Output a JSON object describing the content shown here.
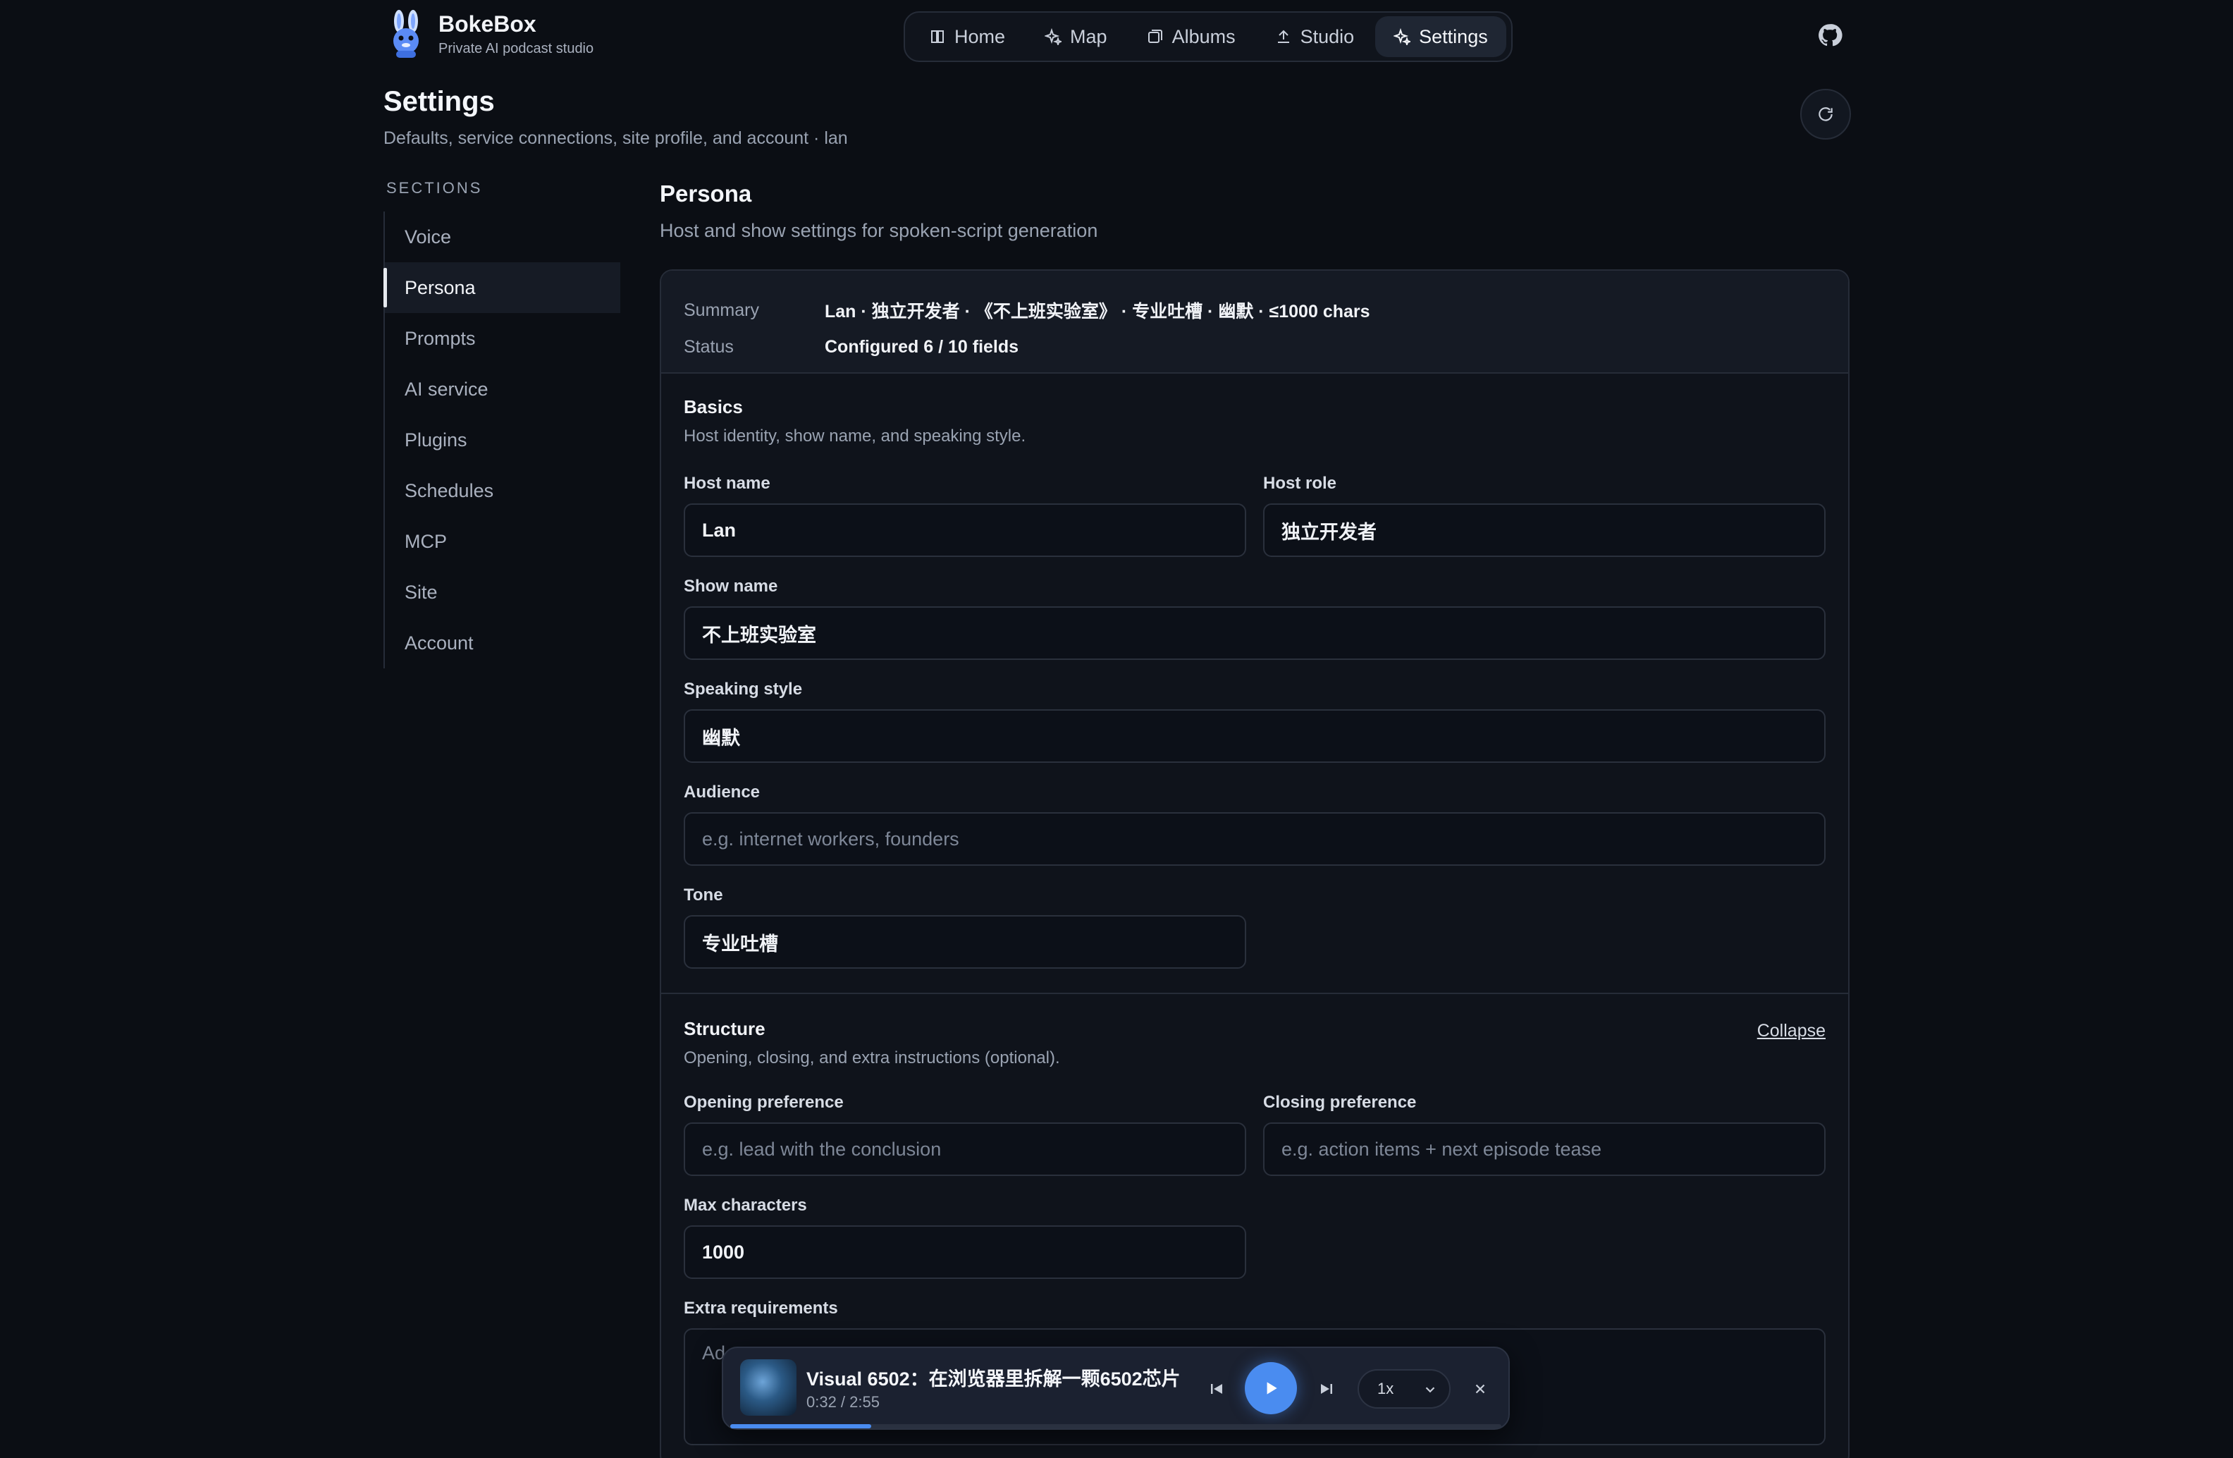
{
  "brand": {
    "name": "BokeBox",
    "tagline": "Private AI podcast studio"
  },
  "nav": [
    {
      "label": "Home",
      "icon": "book-icon"
    },
    {
      "label": "Map",
      "icon": "sparkles-icon"
    },
    {
      "label": "Albums",
      "icon": "albums-icon"
    },
    {
      "label": "Studio",
      "icon": "upload-icon"
    },
    {
      "label": "Settings",
      "icon": "sparkle-icon",
      "active": true
    }
  ],
  "page": {
    "title": "Settings",
    "subtitle": "Defaults, service connections, site profile, and account · lan"
  },
  "sidebar": {
    "heading": "SECTIONS",
    "items": [
      {
        "label": "Voice"
      },
      {
        "label": "Persona",
        "active": true
      },
      {
        "label": "Prompts"
      },
      {
        "label": "AI service"
      },
      {
        "label": "Plugins"
      },
      {
        "label": "Schedules"
      },
      {
        "label": "MCP"
      },
      {
        "label": "Site"
      },
      {
        "label": "Account"
      }
    ]
  },
  "section": {
    "title": "Persona",
    "subtitle": "Host and show settings for spoken-script generation",
    "summary": {
      "summary_label": "Summary",
      "summary_value": "Lan · 独立开发者 · 《不上班实验室》 · 专业吐槽 · 幽默 · ≤1000 chars",
      "status_label": "Status",
      "status_value": "Configured 6 / 10 fields"
    },
    "basics": {
      "title": "Basics",
      "desc": "Host identity, show name, and speaking style.",
      "host_name": {
        "label": "Host name",
        "value": "Lan"
      },
      "host_role": {
        "label": "Host role",
        "value": "独立开发者"
      },
      "show_name": {
        "label": "Show name",
        "value": "不上班实验室"
      },
      "speaking_style": {
        "label": "Speaking style",
        "value": "幽默"
      },
      "audience": {
        "label": "Audience",
        "placeholder": "e.g. internet workers, founders"
      },
      "tone": {
        "label": "Tone",
        "value": "专业吐槽"
      }
    },
    "structure": {
      "title": "Structure",
      "desc": "Opening, closing, and extra instructions (optional).",
      "collapse": "Collapse",
      "opening": {
        "label": "Opening preference",
        "placeholder": "e.g. lead with the conclusion"
      },
      "closing": {
        "label": "Closing preference",
        "placeholder": "e.g. action items + next episode tease"
      },
      "max_chars": {
        "label": "Max characters",
        "value": "1000"
      },
      "extra": {
        "label": "Extra requirements",
        "placeholder": "Ad"
      }
    }
  },
  "player": {
    "title": "Visual 6502：在浏览器里拆解一颗6502芯片",
    "time": "0:32 / 2:55",
    "progress": 0.183,
    "speed": "1x",
    "accent": "#4a8cf0"
  }
}
